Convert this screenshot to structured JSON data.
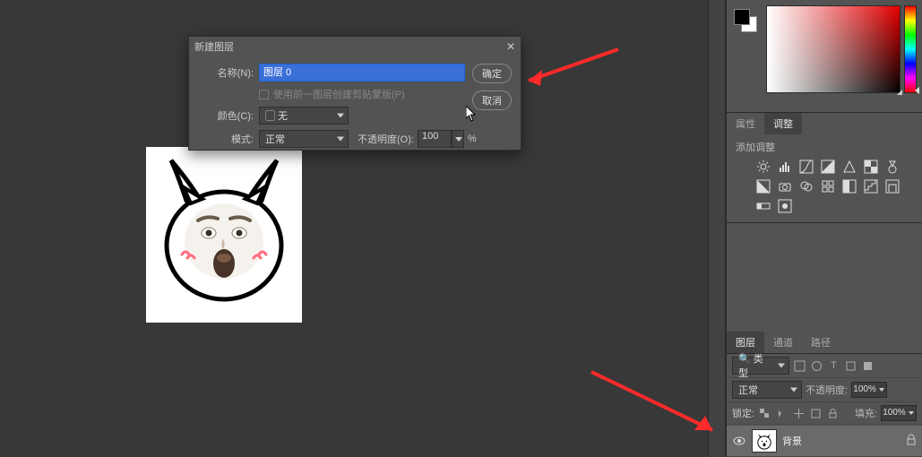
{
  "dialog": {
    "title": "新建图层",
    "name_label": "名称(N):",
    "name_value": "图层 0",
    "clip_checkbox": "使用前一图层创建剪贴蒙版(P)",
    "color_label": "颜色(C):",
    "color_value": "▢ 无",
    "mode_label": "模式:",
    "mode_value": "正常",
    "opacity_label": "不透明度(O):",
    "opacity_value": "100",
    "opacity_unit": "%",
    "ok": "确定",
    "cancel": "取消"
  },
  "props": {
    "tab_properties": "属性",
    "tab_adjustments": "调整",
    "add_adjustment": "添加调整"
  },
  "layers": {
    "tab_layers": "图层",
    "tab_channels": "通道",
    "tab_paths": "路径",
    "kind_label": "🔍 类型",
    "blend_mode": "正常",
    "opacity_label": "不透明度:",
    "opacity_value": "100%",
    "lock_label": "锁定:",
    "fill_label": "填充:",
    "fill_value": "100%",
    "bg_layer": "背景"
  }
}
